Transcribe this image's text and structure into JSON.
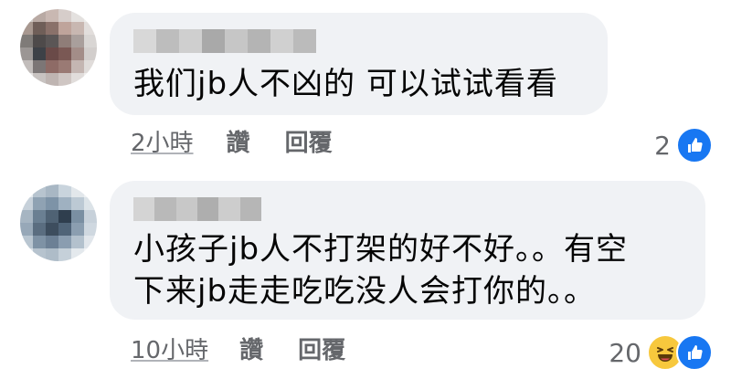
{
  "comments": [
    {
      "body_lines": [
        "我们jb人不凶的  可以试试看看"
      ],
      "time": "2小時",
      "like_label": "讚",
      "reply_label": "回覆",
      "reaction_count": "2",
      "reaction_icons": [
        "like-icon"
      ],
      "author_blurred": true
    },
    {
      "body_lines": [
        "小孩子jb人不打架的好不好。。有空",
        "下来jb走走吃吃没人会打你的。。"
      ],
      "time": "10小時",
      "like_label": "讚",
      "reply_label": "回覆",
      "reaction_count": "20",
      "reaction_icons": [
        "haha-icon",
        "like-icon"
      ],
      "author_blurred": true
    }
  ],
  "colors": {
    "bubble": "#f0f2f5",
    "text": "#050505",
    "secondary": "#65676b",
    "like_blue": "#1877f2",
    "haha_yellow": "#f7c83d"
  }
}
